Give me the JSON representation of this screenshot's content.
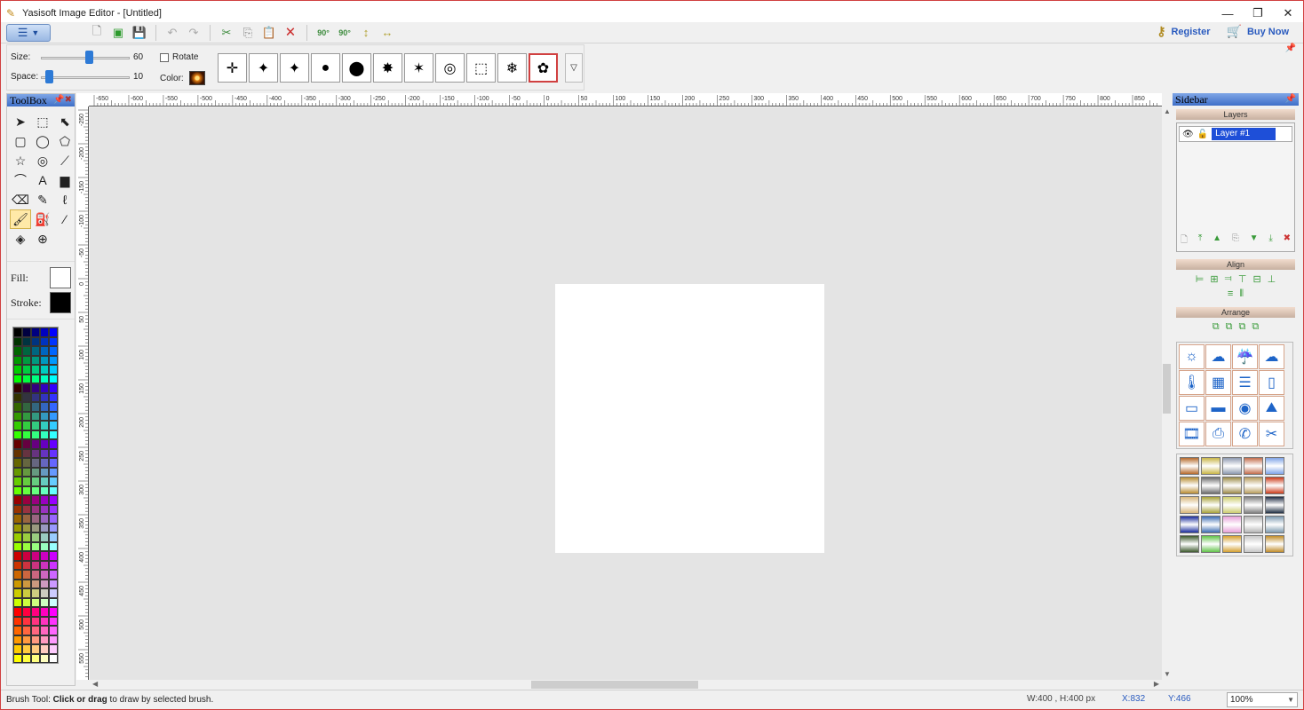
{
  "window": {
    "title": "Yasisoft Image Editor - [Untitled]",
    "controls": [
      "—",
      "❐",
      "✕"
    ]
  },
  "toolbar": {
    "register_label": "Register",
    "buy_label": "Buy Now",
    "rotate_left_label": "90°",
    "rotate_right_label": "90°"
  },
  "brush_options": {
    "size_label": "Size:",
    "size_value": "60",
    "size_fraction": 0.55,
    "space_label": "Space:",
    "space_value": "10",
    "space_fraction": 0.05,
    "rotate_label": "Rotate",
    "color_label": "Color:",
    "brushes": [
      "✛",
      "✦",
      "✦",
      "●",
      "⬤",
      "✸",
      "✶",
      "◎",
      "⬚",
      "❄",
      "✿"
    ],
    "more_label": "▽"
  },
  "toolbox": {
    "title": "ToolBox",
    "tools": [
      {
        "name": "pointer-tool",
        "glyph": "➤"
      },
      {
        "name": "transform-tool",
        "glyph": "⬚"
      },
      {
        "name": "node-tool",
        "glyph": "⬉"
      },
      {
        "name": "rectangle-tool",
        "glyph": "▢"
      },
      {
        "name": "ellipse-tool",
        "glyph": "◯"
      },
      {
        "name": "polygon-tool",
        "glyph": "⬠"
      },
      {
        "name": "star-tool",
        "glyph": "☆"
      },
      {
        "name": "spiral-tool",
        "glyph": "◎"
      },
      {
        "name": "line-tool",
        "glyph": "⟋"
      },
      {
        "name": "bezier-tool",
        "glyph": "⌒"
      },
      {
        "name": "text-tool",
        "glyph": "A"
      },
      {
        "name": "image-tool",
        "glyph": "▆"
      },
      {
        "name": "eraser-tool",
        "glyph": "⌫"
      },
      {
        "name": "pencil-tool",
        "glyph": "✎"
      },
      {
        "name": "calligraphy-tool",
        "glyph": "ℓ"
      },
      {
        "name": "brush-tool",
        "glyph": "🖌"
      },
      {
        "name": "spray-tool",
        "glyph": "⛽"
      },
      {
        "name": "eyedropper-tool",
        "glyph": "⁄"
      },
      {
        "name": "fill-tool",
        "glyph": "◈"
      },
      {
        "name": "zoom-tool",
        "glyph": "⊕"
      }
    ],
    "fill_label": "Fill:",
    "stroke_label": "Stroke:",
    "fill_color": "#ffffff",
    "stroke_color": "#000000"
  },
  "ruler": {
    "h_labels": [
      "-650",
      "-600",
      "-550",
      "-500",
      "-450",
      "-400",
      "-350",
      "-300",
      "-250",
      "-200",
      "-150",
      "-100",
      "-50",
      "0",
      "50",
      "100",
      "150",
      "200",
      "250",
      "300",
      "350",
      "400",
      "450",
      "500",
      "550",
      "600",
      "650",
      "700",
      "750",
      "800",
      "850"
    ],
    "v_labels": [
      "-250",
      "-200",
      "-150",
      "-100",
      "-50",
      "0",
      "50",
      "100",
      "150",
      "200",
      "250",
      "300",
      "350",
      "400",
      "450",
      "500",
      "550"
    ]
  },
  "sidebar": {
    "title": "Sidebar",
    "layers_title": "Layers",
    "layer_name": "Layer #1",
    "align_title": "Align",
    "arrange_title": "Arrange",
    "shapes": [
      "☼",
      "☁",
      "☔",
      "☁",
      "🌡",
      "▦",
      "☰",
      "▯",
      "▭",
      "▬",
      "◉",
      "⛰",
      "🎞",
      "⎙",
      "✆",
      "✂"
    ],
    "gradients": [
      "#b66a2c",
      "#c9b648",
      "#8d99b0",
      "#c36d4d",
      "#7fa4e8",
      "#b98d33",
      "#6c6c6c",
      "#9c8a48",
      "#b79c5c",
      "#cc3b1a",
      "#d8b67a",
      "#a7a23a",
      "#cccc6e",
      "#808080",
      "#223045",
      "#1a2c9c",
      "#3c6cb2",
      "#e7a0d8",
      "#b4b4b4",
      "#7d9ab0",
      "#3e5a2e",
      "#62c34a",
      "#d5a030",
      "#c7c7c7",
      "#c18d2b"
    ]
  },
  "status": {
    "tool_name": "Brush Tool:",
    "hint_bold": "Click or drag",
    "hint_rest": "to draw by selected brush.",
    "dimensions": "W:400 , H:400 px",
    "x": "X:832",
    "y": "Y:466",
    "zoom": "100%"
  }
}
